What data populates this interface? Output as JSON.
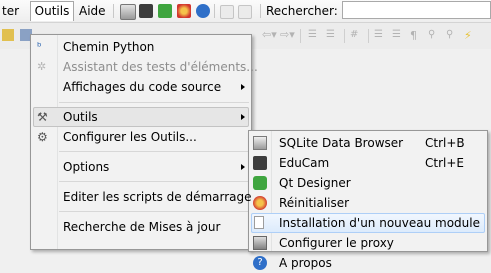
{
  "menubar": {
    "item_ter": "ter",
    "item_outils": "Outils",
    "item_aide": "Aide",
    "search_label": "Rechercher:"
  },
  "outils_menu": {
    "chemin_python": "Chemin Python",
    "assistant": "Assistant des tests d'éléments...",
    "affichages": "Affichages du code source",
    "outils": "Outils",
    "configurer": "Configurer les Outils...",
    "options": "Options",
    "editer": "Editer les scripts de démarrage",
    "recherche": "Recherche de Mises à jour"
  },
  "outils_submenu": {
    "sqlite": "SQLite Data Browser",
    "sqlite_shortcut": "Ctrl+B",
    "educam": "EduCam",
    "educam_shortcut": "Ctrl+E",
    "qt": "Qt Designer",
    "reinit": "Réinitialiser",
    "install": "Installation d'un nouveau module",
    "proxy": "Configurer le proxy",
    "apropos": "A propos"
  },
  "colors": {
    "highlight_border": "#aecff7",
    "menu_bg": "#f2f2f2"
  }
}
